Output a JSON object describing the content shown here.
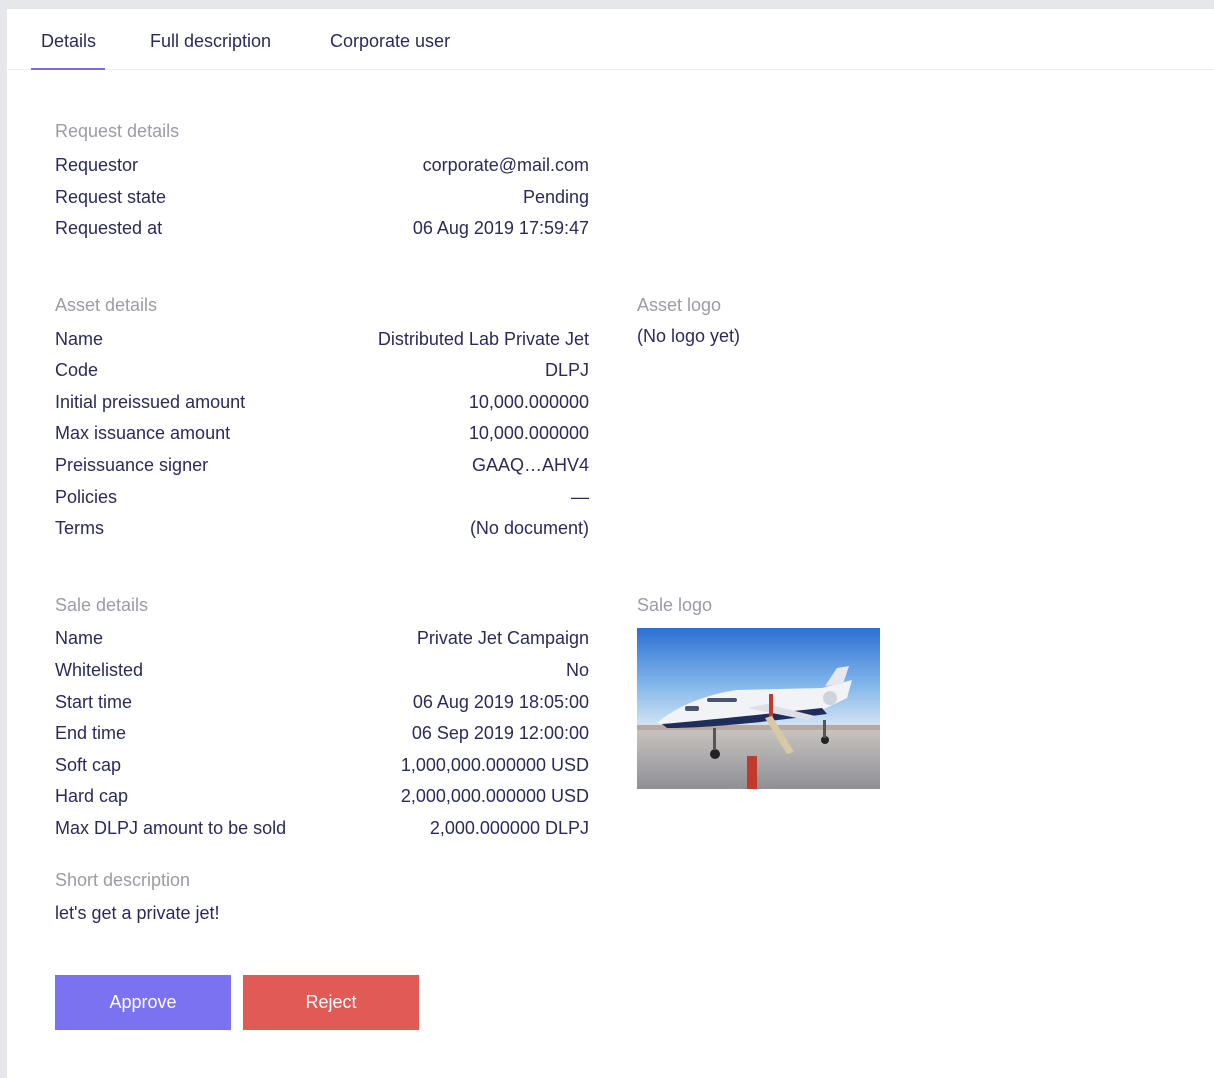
{
  "tabs": [
    {
      "label": "Details"
    },
    {
      "label": "Full description"
    },
    {
      "label": "Corporate user"
    }
  ],
  "request": {
    "title": "Request details",
    "rows": [
      {
        "label": "Requestor",
        "value": "corporate@mail.com"
      },
      {
        "label": "Request state",
        "value": "Pending"
      },
      {
        "label": "Requested at",
        "value": "06 Aug 2019 17:59:47"
      }
    ]
  },
  "asset": {
    "title": "Asset details",
    "rows": [
      {
        "label": "Name",
        "value": "Distributed Lab Private Jet"
      },
      {
        "label": "Code",
        "value": "DLPJ"
      },
      {
        "label": "Initial preissued amount",
        "value": "10,000.000000"
      },
      {
        "label": "Max issuance amount",
        "value": "10,000.000000"
      },
      {
        "label": "Preissuance signer",
        "value": "GAAQ…AHV4"
      },
      {
        "label": "Policies",
        "value": "—"
      },
      {
        "label": "Terms",
        "value": "(No document)"
      }
    ],
    "logo_title": "Asset logo",
    "logo_text": "(No logo yet)"
  },
  "sale": {
    "title": "Sale details",
    "rows": [
      {
        "label": "Name",
        "value": "Private Jet Campaign"
      },
      {
        "label": "Whitelisted",
        "value": "No"
      },
      {
        "label": "Start time",
        "value": "06 Aug 2019 18:05:00"
      },
      {
        "label": "End time",
        "value": "06 Sep 2019 12:00:00"
      },
      {
        "label": "Soft cap",
        "value": "1,000,000.000000 USD"
      },
      {
        "label": "Hard cap",
        "value": "2,000,000.000000 USD"
      },
      {
        "label": "Max DLPJ amount to be sold",
        "value": "2,000.000000 DLPJ"
      }
    ],
    "logo_title": "Sale logo"
  },
  "short_description": {
    "title": "Short description",
    "text": "let's get a private jet!"
  },
  "actions": {
    "approve_label": "Approve",
    "reject_label": "Reject"
  },
  "colors": {
    "accent": "#7a72f0",
    "danger": "#e05b55",
    "text": "#2a2b5b",
    "muted": "#9b9ba7"
  }
}
